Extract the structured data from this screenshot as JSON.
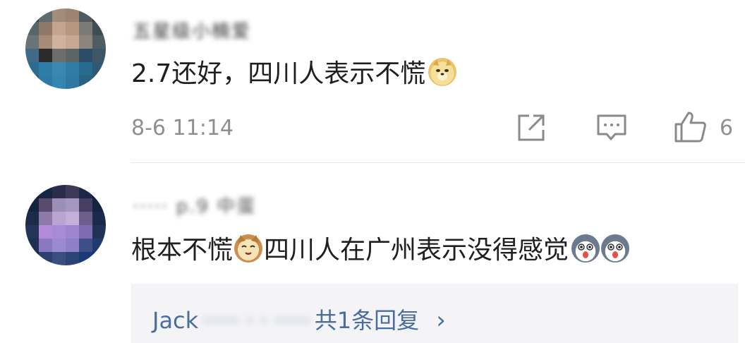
{
  "comments": [
    {
      "username": "五星级小楠爱",
      "text": "2.7还好，四川人表示不慌",
      "emoji": "doge-emoji",
      "timestamp": "8-6 11:14",
      "like_count": "6"
    },
    {
      "username": "····· p.9 中蛋",
      "text_before_emoji": "根本不慌",
      "emoji": "cat-emoji",
      "text_after_emoji": "四川人在广州表示没得感觉",
      "trailing_emojis": [
        "husky-emoji",
        "husky-emoji"
      ],
      "reply": {
        "name_start": "Jack",
        "name_hidden": "····· · · ·····",
        "summary": "共1条回复",
        "chevron": "›"
      }
    }
  ],
  "icons": {
    "share": "share-icon",
    "comment": "comment-icon",
    "like": "thumbs-up-icon"
  },
  "colors": {
    "text": "#1f1f1f",
    "meta": "#8f8f8f",
    "link": "#4a6d9c",
    "reply_bg": "#f4f4f6",
    "divider": "#e6e6e6"
  }
}
